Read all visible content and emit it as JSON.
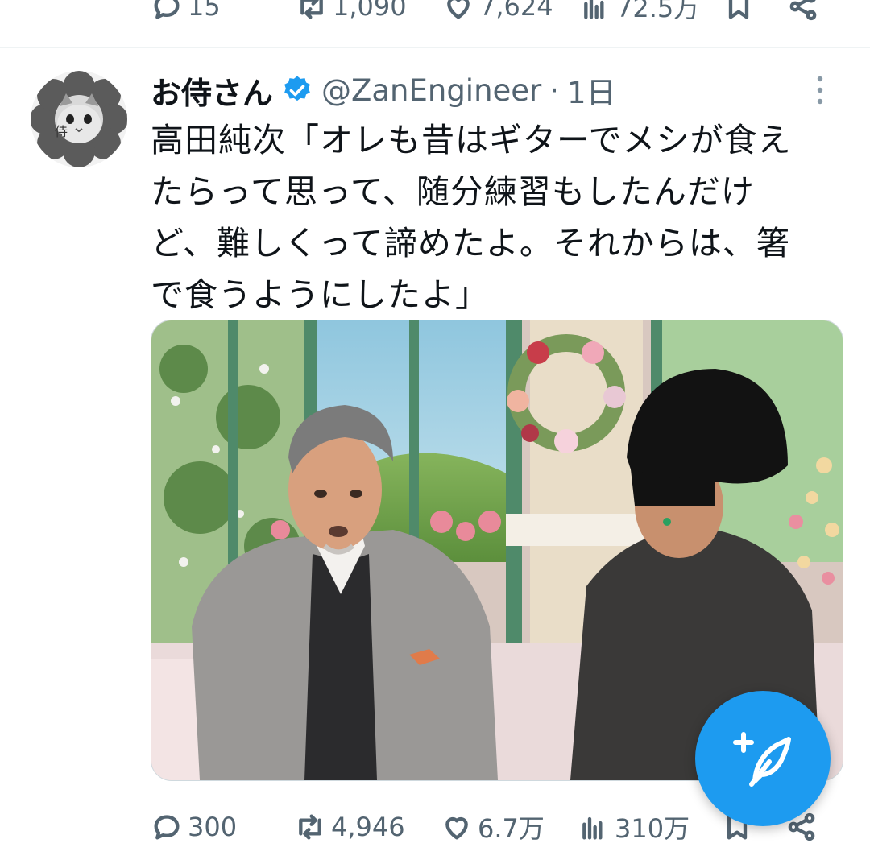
{
  "previous_tweet": {
    "actions": {
      "replies": "15",
      "retweets": "1,090",
      "likes": "7,624",
      "views": "72.5万"
    }
  },
  "tweet": {
    "author_name": "お侍さん",
    "handle": "@ZanEngineer",
    "separator": "·",
    "time": "1日",
    "avatar_label": "侍",
    "text": "高田純次「オレも昔はギターでメシが食え\nたらって思って、随分練習もしたんだけ\nど、難しくって諦めたよ。それからは、箸\nで食うようにしたよ」",
    "actions": {
      "replies": "300",
      "retweets": "4,946",
      "likes": "6.7万",
      "views": "310万"
    }
  },
  "colors": {
    "accent": "#1d9bf0",
    "text_primary": "#0f1419",
    "text_secondary": "#536471"
  },
  "icons": {
    "reply": "reply-icon",
    "retweet": "retweet-icon",
    "like": "heart-icon",
    "views": "views-icon",
    "bookmark": "bookmark-icon",
    "share": "share-icon",
    "verified": "verified-badge-icon",
    "more": "more-options-icon",
    "compose": "compose-tweet-icon"
  }
}
